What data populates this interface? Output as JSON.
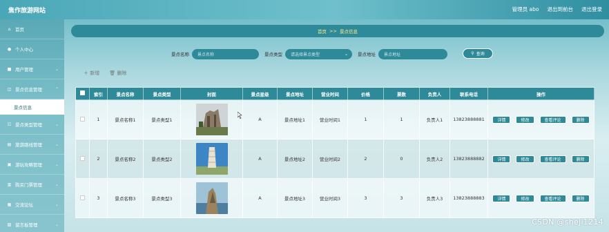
{
  "app": {
    "title": "焦作旅游网站",
    "top_links": [
      "管理员 abo",
      "退出到前台",
      "退出登录"
    ]
  },
  "sidebar": {
    "items": [
      {
        "label": "首页",
        "icon": "home-icon",
        "glyph": "⌂"
      },
      {
        "label": "个人中心",
        "icon": "user-icon",
        "glyph": "●"
      },
      {
        "label": "用户管理",
        "icon": "users-icon",
        "glyph": "■"
      },
      {
        "label": "景点信息管理",
        "icon": "grid-icon",
        "glyph": "◫"
      },
      {
        "label": "景点信息",
        "sub": true
      },
      {
        "label": "景点类型管理",
        "icon": "list-icon",
        "glyph": "☷"
      },
      {
        "label": "旅游路线管理",
        "icon": "route-icon",
        "glyph": "▤"
      },
      {
        "label": "游玩攻略管理",
        "icon": "guide-icon",
        "glyph": "▣"
      },
      {
        "label": "购买门票管理",
        "icon": "ticket-icon",
        "glyph": "▥"
      },
      {
        "label": "交流论坛",
        "icon": "forum-icon",
        "glyph": "▦"
      },
      {
        "label": "留言板管理",
        "icon": "message-icon",
        "glyph": "▧"
      }
    ]
  },
  "breadcrumb": {
    "home": "首页",
    "sep": ">>",
    "current": "景点信息"
  },
  "search": {
    "name_label": "景点名称",
    "name_placeholder": "景点名称",
    "type_label": "景点类型",
    "type_placeholder": "请选择景点类型",
    "addr_label": "景点地址",
    "addr_placeholder": "景点地址",
    "button": "查询"
  },
  "actions": {
    "add": "新增",
    "delete": "删除"
  },
  "table": {
    "headers": [
      "索引",
      "景点名称",
      "景点类型",
      "封面",
      "景点星级",
      "景点地址",
      "营业时间",
      "价格",
      "票数",
      "负责人",
      "联系电话",
      "操作"
    ],
    "rows": [
      {
        "index": "1",
        "name": "景点名称1",
        "type": "景点类型1",
        "star": "A",
        "addr": "景点地址1",
        "hours": "营业时间1",
        "price": "1",
        "tickets": "1",
        "person": "负责人1",
        "phone": "13823888881"
      },
      {
        "index": "2",
        "name": "景点名称2",
        "type": "景点类型2",
        "star": "A",
        "addr": "景点地址2",
        "hours": "营业时间2",
        "price": "2",
        "tickets": "0",
        "person": "负责人2",
        "phone": "13823888882"
      },
      {
        "index": "3",
        "name": "景点名称3",
        "type": "景点类型3",
        "star": "A",
        "addr": "景点地址3",
        "hours": "营业时间3",
        "price": "3",
        "tickets": "3",
        "person": "负责人3",
        "phone": "13823888883"
      }
    ],
    "ops": {
      "detail": "详情",
      "edit": "修改",
      "review": "查看评论",
      "delete": "删除"
    }
  },
  "watermark": "CSDN @sheji1214",
  "colors": {
    "accent": "#2e8a98",
    "link": "#ffe98a"
  }
}
